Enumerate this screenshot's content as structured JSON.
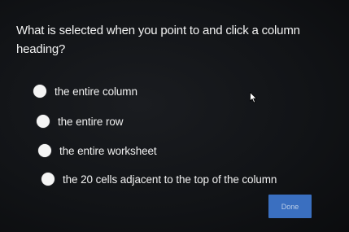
{
  "quiz": {
    "question": "What is selected when you point to and click a column heading?",
    "options": [
      {
        "label": "the entire column",
        "selected": false
      },
      {
        "label": "the entire row",
        "selected": false
      },
      {
        "label": "the entire worksheet",
        "selected": false
      },
      {
        "label": "the 20 cells adjacent to the top of the column",
        "selected": false
      }
    ],
    "done_label": "Done"
  },
  "icons": {
    "pointer": "arrow-cursor-icon",
    "radio": "radio-button-icon"
  },
  "colors": {
    "background": "#111316",
    "text": "#f0f0f0",
    "radio": "#f4f4f4",
    "done_button": "#3a6fc0"
  }
}
